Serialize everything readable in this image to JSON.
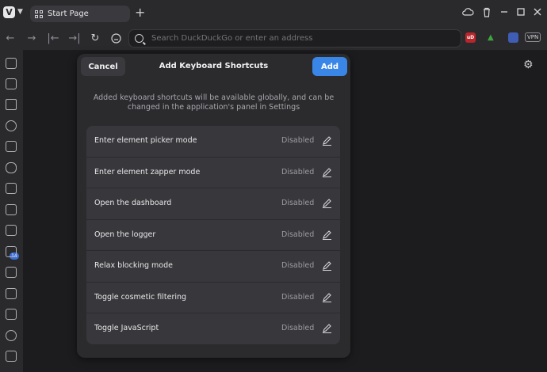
{
  "titlebar": {
    "tab_label": "Start Page"
  },
  "navbar": {
    "address_placeholder": "Search DuckDuckGo or enter an address",
    "ublock_label": "uD",
    "vpn_label": "VPN"
  },
  "sidebar": {
    "mail_badge": "14"
  },
  "dialog": {
    "title": "Add Keyboard Shortcuts",
    "cancel_label": "Cancel",
    "add_label": "Add",
    "description": "Added keyboard shortcuts will be available globally, and can be changed in the application's panel in Settings",
    "shortcuts": [
      {
        "label": "Enter element picker mode",
        "status": "Disabled"
      },
      {
        "label": "Enter element zapper mode",
        "status": "Disabled"
      },
      {
        "label": "Open the dashboard",
        "status": "Disabled"
      },
      {
        "label": "Open the logger",
        "status": "Disabled"
      },
      {
        "label": "Relax blocking mode",
        "status": "Disabled"
      },
      {
        "label": "Toggle cosmetic filtering",
        "status": "Disabled"
      },
      {
        "label": "Toggle JavaScript",
        "status": "Disabled"
      }
    ]
  },
  "colors": {
    "accent": "#3a86e6",
    "background": "#1c1c1f",
    "panel": "#2b2b2e",
    "row": "#38383c"
  }
}
